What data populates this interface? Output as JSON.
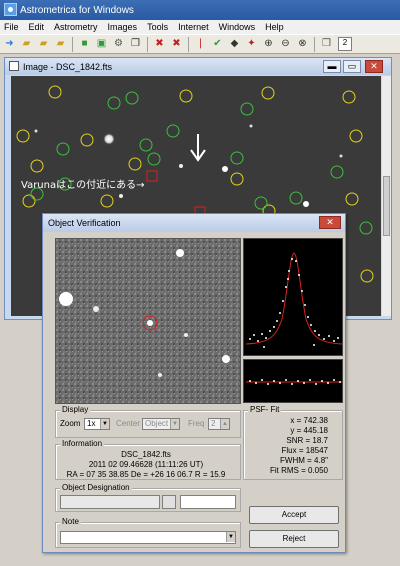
{
  "app": {
    "title": "Astrometrica for Windows"
  },
  "menu": [
    "File",
    "Edit",
    "Astrometry",
    "Images",
    "Tools",
    "Internet",
    "Windows",
    "Help"
  ],
  "toolbar": {
    "icons": [
      "send-icon",
      "open-folder-icon",
      "open-folder-icon",
      "open-folder-icon",
      "folder-icon",
      "green-square-icon",
      "settings-icon",
      "copy-icon",
      "red-cross-icon",
      "red-cross-icon",
      "red-mark-icon",
      "check-icon",
      "diamond-icon",
      "star-icon",
      "zoom-in-icon",
      "zoom-out-icon",
      "fit-icon",
      "stack-icon"
    ],
    "zoom_value": "2"
  },
  "image_window": {
    "title": "Image - DSC_1842.fts"
  },
  "annotation": {
    "text": "Varunaはこの付近にある→"
  },
  "dialog": {
    "title": "Object Verification",
    "display": {
      "legend": "Display",
      "zoom_label": "Zoom",
      "zoom_value": "1x",
      "center_label": "Center",
      "center_value": "Object",
      "freq_label": "Freq",
      "freq_value": "2"
    },
    "information": {
      "legend": "Information",
      "filename": "DSC_1842.fts",
      "date": "2011 02 09.46628 (11:11:26 UT)",
      "coords": "RA = 07 35 38.85  De = +26 16 06.7  R = 15.9"
    },
    "psf": {
      "legend": "PSF- Fit",
      "x": "x = 742.38",
      "y": "y = 445.18",
      "snr": "SNR = 18.7",
      "flux": "Flux = 18547",
      "fwhm": "FWHM = 4.8\"",
      "fit_rms": "Fit RMS = 0.050"
    },
    "designation": {
      "legend": "Object Designation"
    },
    "note": {
      "legend": "Note"
    },
    "buttons": {
      "accept": "Accept",
      "reject": "Reject"
    }
  }
}
